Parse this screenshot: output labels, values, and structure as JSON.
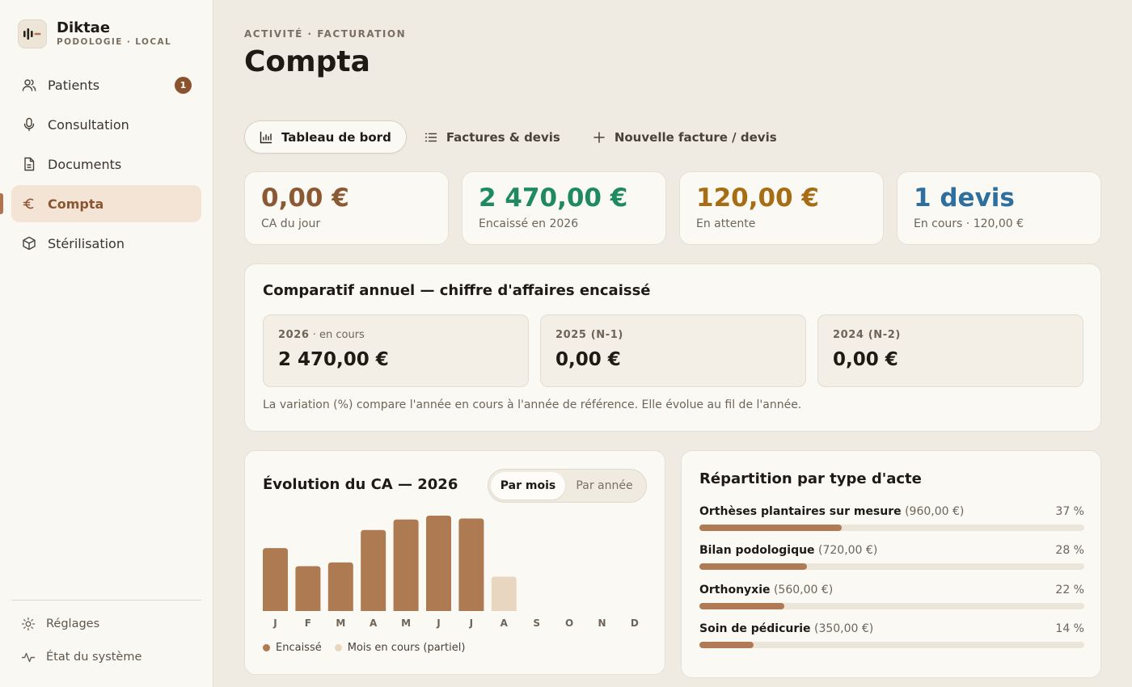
{
  "brand": {
    "name": "Diktae",
    "subtitle": "PODOLOGIE · LOCAL"
  },
  "nav": [
    {
      "label": "Patients",
      "icon": "users-icon",
      "badge": "1"
    },
    {
      "label": "Consultation",
      "icon": "microphone-icon"
    },
    {
      "label": "Documents",
      "icon": "document-icon"
    },
    {
      "label": "Compta",
      "icon": "euro-icon",
      "active": true
    },
    {
      "label": "Stérilisation",
      "icon": "box-icon"
    }
  ],
  "footer": [
    {
      "label": "Réglages",
      "icon": "gear-icon"
    },
    {
      "label": "État du système",
      "icon": "activity-icon"
    }
  ],
  "header": {
    "eyebrow": "ACTIVITÉ · FACTURATION",
    "title": "Compta"
  },
  "tabs": [
    {
      "label": "Tableau de bord",
      "icon": "bar-chart-icon",
      "active": true
    },
    {
      "label": "Factures & devis",
      "icon": "list-icon"
    },
    {
      "label": "Nouvelle facture / devis",
      "icon": "plus-icon"
    }
  ],
  "kpis": [
    {
      "value": "0,00 €",
      "label": "CA du jour",
      "color": "#8b5a35"
    },
    {
      "value": "2 470,00 €",
      "label": "Encaissé en 2026",
      "color": "#1f8a5e"
    },
    {
      "value": "120,00 €",
      "label": "En attente",
      "color": "#a66d14"
    },
    {
      "value": "1 devis",
      "label": "En cours · 120,00 €",
      "color": "#2f6f9e"
    }
  ],
  "comparatif": {
    "title": "Comparatif annuel — chiffre d'affaires encaissé",
    "years": [
      {
        "year": "2026",
        "suffix": " · en cours",
        "value": "2 470,00 €"
      },
      {
        "year": "2025 (N-1)",
        "suffix": "",
        "value": "0,00 €"
      },
      {
        "year": "2024 (N-2)",
        "suffix": "",
        "value": "0,00 €"
      }
    ],
    "note": "La variation (%) compare l'année en cours à l'année de référence. Elle évolue au fil de l'année."
  },
  "evolution": {
    "title": "Évolution du CA — 2026",
    "toggle": {
      "active": "Par mois",
      "inactive": "Par année"
    },
    "legend": {
      "paid": "Encaissé",
      "partial": "Mois en cours (partiel)"
    },
    "colors": {
      "paid": "#ad7a52",
      "partial": "#e8d6c1"
    }
  },
  "chart_data": {
    "type": "bar",
    "categories": [
      "J",
      "F",
      "M",
      "A",
      "M",
      "J",
      "J",
      "A",
      "S",
      "O",
      "N",
      "D"
    ],
    "values": [
      66,
      47,
      51,
      85,
      96,
      100,
      97,
      36,
      0,
      0,
      0,
      0
    ],
    "partial_index": 7,
    "ylim": [
      0,
      100
    ],
    "title": "Évolution du CA — 2026"
  },
  "repartition": {
    "title": "Répartition par type d'acte",
    "items": [
      {
        "name": "Orthèses plantaires sur mesure",
        "amount": "(960,00 €)",
        "pct_label": "37 %",
        "pct": 37
      },
      {
        "name": "Bilan podologique",
        "amount": "(720,00 €)",
        "pct_label": "28 %",
        "pct": 28
      },
      {
        "name": "Orthonyxie",
        "amount": "(560,00 €)",
        "pct_label": "22 %",
        "pct": 22
      },
      {
        "name": "Soin de pédicurie",
        "amount": "(350,00 €)",
        "pct_label": "14 %",
        "pct": 14
      }
    ]
  }
}
